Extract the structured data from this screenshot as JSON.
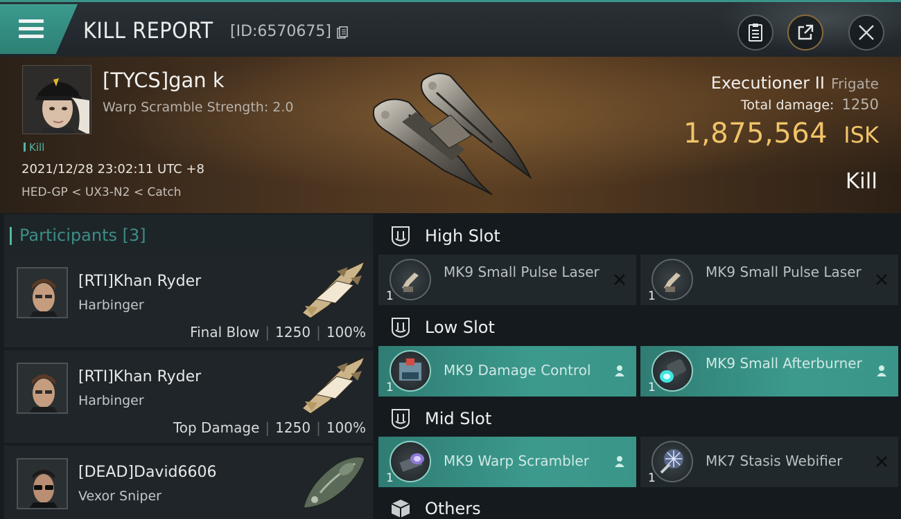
{
  "header": {
    "title": "KILL REPORT",
    "report_id": "[ID:6570675]",
    "buttons": [
      "clipboard-icon",
      "share-icon",
      "close-icon"
    ]
  },
  "victim": {
    "name": "[TYCS]gan k",
    "stat": "Warp Scramble Strength: 2.0",
    "tag": "Kill",
    "datetime": "2021/12/28 23:02:11 UTC +8",
    "route": "HED-GP < UX3-N2 < Catch",
    "ship_name": "Executioner II",
    "ship_class": "Frigate",
    "damage_label": "Total damage:",
    "damage_value": "1250",
    "isk_value": "1,875,564",
    "isk_unit": "ISK",
    "result": "Kill"
  },
  "participants": {
    "title": "Participants [3]",
    "rows": [
      {
        "name": "[RTI]Khan Ryder",
        "ship": "Harbinger",
        "role": "Final Blow",
        "damage": "1250",
        "percent": "100%"
      },
      {
        "name": "[RTI]Khan Ryder",
        "ship": "Harbinger",
        "role": "Top Damage",
        "damage": "1250",
        "percent": "100%"
      },
      {
        "name": "[DEAD]David6606",
        "ship": "Vexor Sniper"
      }
    ]
  },
  "slots": {
    "high": {
      "label": "High Slot",
      "modules": [
        {
          "name": "MK9 Small Pulse Laser",
          "qty": "1",
          "state": "destroyed",
          "icon": "pulse-laser-icon"
        },
        {
          "name": "MK9 Small Pulse Laser",
          "qty": "1",
          "state": "destroyed",
          "icon": "pulse-laser-icon"
        }
      ]
    },
    "low": {
      "label": "Low Slot",
      "modules": [
        {
          "name": "MK9 Damage Control",
          "qty": "1",
          "state": "dropped",
          "icon": "damage-control-icon"
        },
        {
          "name": "MK9 Small Afterburner",
          "qty": "1",
          "state": "dropped",
          "icon": "afterburner-icon"
        }
      ]
    },
    "mid": {
      "label": "Mid Slot",
      "modules": [
        {
          "name": "MK9 Warp Scrambler",
          "qty": "1",
          "state": "dropped",
          "icon": "warp-scrambler-icon"
        },
        {
          "name": "MK7 Stasis Webifier",
          "qty": "1",
          "state": "destroyed",
          "icon": "stasis-webifier-icon"
        }
      ]
    },
    "others": {
      "label": "Others"
    }
  },
  "colors": {
    "accent": "#3c9a8d",
    "isk": "#f0c469",
    "panel": "#1f2529"
  }
}
